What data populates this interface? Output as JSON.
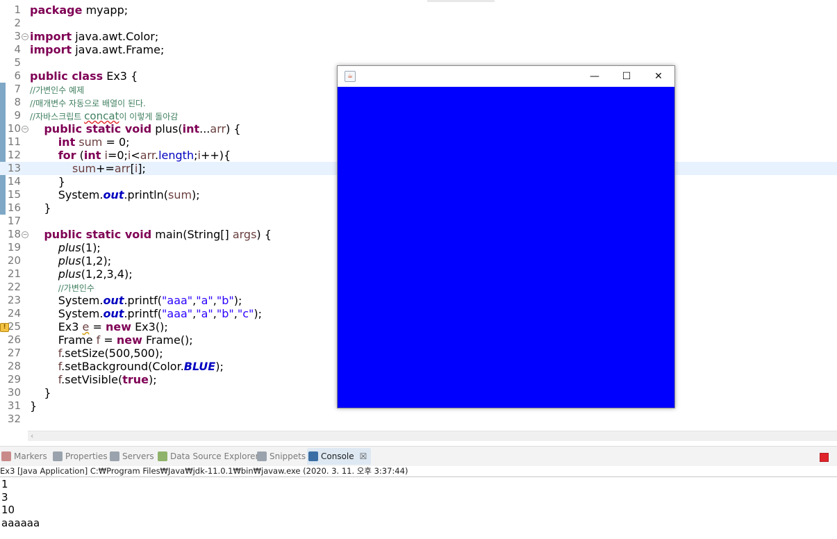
{
  "editor": {
    "lines": [
      {
        "n": "1",
        "html": "<span class=\"kw\">package</span> myapp;"
      },
      {
        "n": "2",
        "html": ""
      },
      {
        "n": "3",
        "fold": true,
        "html": "<span class=\"kw\">import</span> java.awt.Color;"
      },
      {
        "n": "4",
        "html": "<span class=\"kw\">import</span> java.awt.Frame;"
      },
      {
        "n": "5",
        "html": ""
      },
      {
        "n": "6",
        "html": "<span class=\"kw\">public class</span> Ex3 {"
      },
      {
        "n": "7",
        "html": "<span class=\"cm\">//가변인수 예제</span>"
      },
      {
        "n": "8",
        "html": "<span class=\"cm\">//매개변수 자동으로 배열이 된다.</span>"
      },
      {
        "n": "9",
        "html": "<span class=\"cm\">//자바스크립트 <span class=\"squigr\" style=\"font-size:15px\">concat</span>이 이렇게 돌아감</span>"
      },
      {
        "n": "10",
        "fold": true,
        "html": "    <span class=\"kw\">public static void</span> plus(<span class=\"kw\">int</span>...<span class=\"var\">arr</span>) {"
      },
      {
        "n": "11",
        "html": "        <span class=\"kw\">int</span> <span class=\"var\">sum</span> = 0;"
      },
      {
        "n": "12",
        "html": "        <span class=\"kw\">for</span> (<span class=\"kw\">int</span> <span class=\"var\">i</span>=0;<span class=\"var\">i</span>&lt;<span class=\"var\">arr</span>.<span class=\"fld\">length</span>;<span class=\"var\">i</span>++){"
      },
      {
        "n": "13",
        "current": true,
        "html": "            <span class=\"var\">sum</span>+=<span class=\"var\">arr</span>[<span class=\"var\">i</span>];"
      },
      {
        "n": "14",
        "html": "        }"
      },
      {
        "n": "15",
        "html": "        System.<span class=\"sfld\">out</span>.println(<span class=\"var\">sum</span>);"
      },
      {
        "n": "16",
        "html": "    }"
      },
      {
        "n": "17",
        "html": ""
      },
      {
        "n": "18",
        "fold": true,
        "html": "    <span class=\"kw\">public static void</span> main(String[] <span class=\"var\">args</span>) {"
      },
      {
        "n": "19",
        "html": "        <span class=\"it\">plus</span>(1);"
      },
      {
        "n": "20",
        "html": "        <span class=\"it\">plus</span>(1,2);"
      },
      {
        "n": "21",
        "html": "        <span class=\"it\">plus</span>(1,2,3,4);"
      },
      {
        "n": "22",
        "html": "        <span class=\"cm\">//가변인수</span>"
      },
      {
        "n": "23",
        "html": "        System.<span class=\"sfld\">out</span>.printf(<span class=\"str\">\"aaa\"</span>,<span class=\"str\">\"a\"</span>,<span class=\"str\">\"b\"</span>);"
      },
      {
        "n": "24",
        "html": "        System.<span class=\"sfld\">out</span>.printf(<span class=\"str\">\"aaa\"</span>,<span class=\"str\">\"a\"</span>,<span class=\"str\">\"b\"</span>,<span class=\"str\">\"c\"</span>);"
      },
      {
        "n": "25",
        "warn": true,
        "html": "        Ex3 <span class=\"var squig\">e</span> = <span class=\"kw\">new</span> Ex3();"
      },
      {
        "n": "26",
        "html": "        Frame <span class=\"var\">f</span> = <span class=\"kw\">new</span> Frame();"
      },
      {
        "n": "27",
        "html": "        <span class=\"var\">f</span>.setSize(500,500);"
      },
      {
        "n": "28",
        "html": "        <span class=\"var\">f</span>.setBackground(Color.<span class=\"sfld\">BLUE</span>);"
      },
      {
        "n": "29",
        "html": "        <span class=\"var\">f</span>.setVisible(<span class=\"kw\">true</span>);"
      },
      {
        "n": "30",
        "html": "    }"
      },
      {
        "n": "31",
        "html": "}"
      },
      {
        "n": "32",
        "html": ""
      }
    ]
  },
  "views": {
    "tabs": [
      {
        "label": "Markers",
        "icon": "markers-icon",
        "color": "#c98a8a"
      },
      {
        "label": "Properties",
        "icon": "properties-icon",
        "color": "#9aa3ad"
      },
      {
        "label": "Servers",
        "icon": "servers-icon",
        "color": "#9aa3ad"
      },
      {
        "label": "Data Source Explorer",
        "icon": "data-source-icon",
        "color": "#8fb36b"
      },
      {
        "label": "Snippets",
        "icon": "snippets-icon",
        "color": "#9aa3ad"
      },
      {
        "label": "Console",
        "icon": "console-icon",
        "color": "#3a6ea5",
        "active": true
      }
    ],
    "close_glyph": "☒"
  },
  "console": {
    "title": "Ex3 [Java Application] C:₩Program Files₩Java₩jdk-11.0.1₩bin₩javaw.exe (2020. 3. 11. 오후 3:37:44)",
    "output": [
      "1",
      "3",
      "10",
      "aaaaaa"
    ]
  },
  "frame_window": {
    "background": "#0000ff",
    "java_icon_glyph": "☕",
    "minimize_glyph": "—",
    "maximize_glyph": "☐",
    "close_glyph": "✕"
  },
  "scroll": {
    "left_arrow": "‹"
  }
}
